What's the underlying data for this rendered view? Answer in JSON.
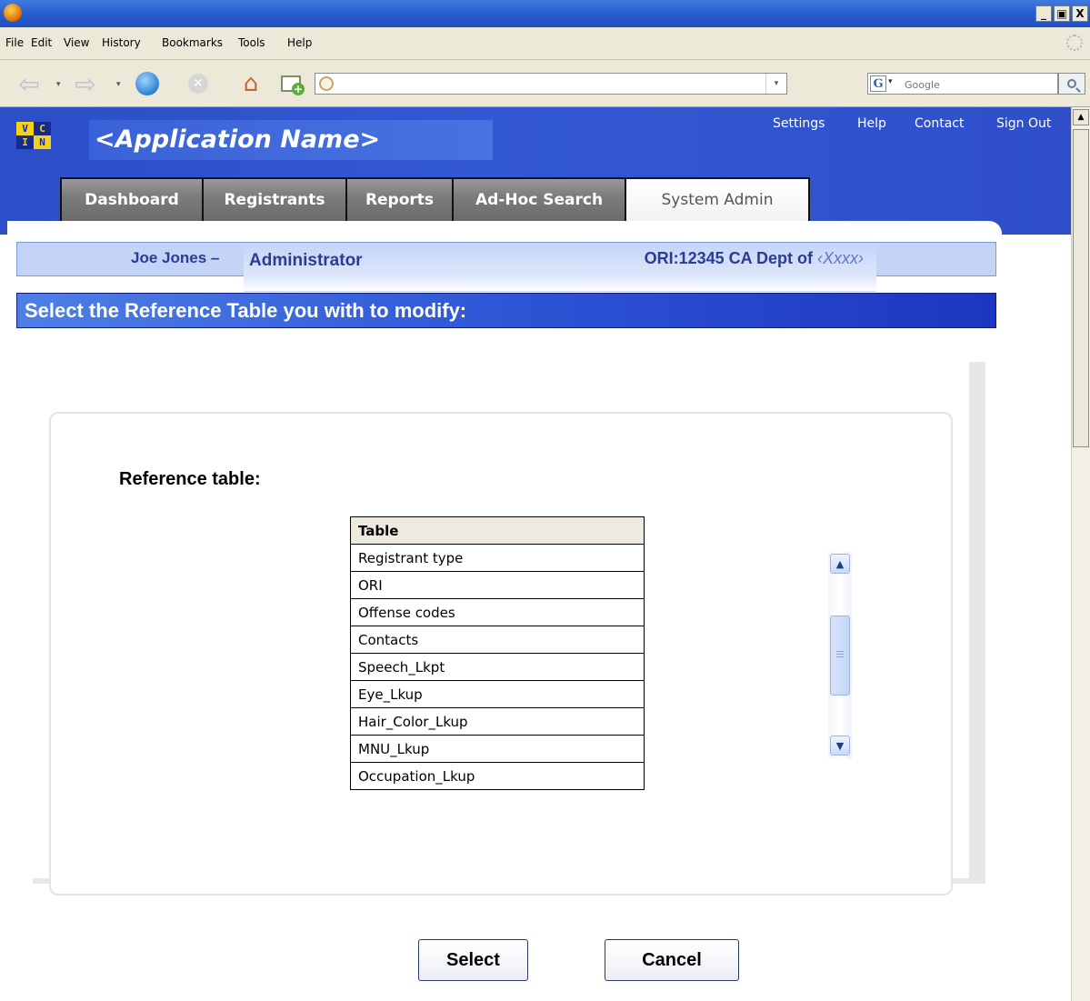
{
  "browser": {
    "menu": [
      "File",
      "Edit",
      "View",
      "History",
      "Bookmarks",
      "Tools",
      "Help"
    ],
    "window_buttons": [
      "_",
      "▣",
      "X"
    ],
    "url": "",
    "search_engine": "G",
    "search_placeholder": "Google"
  },
  "app": {
    "logo": [
      "V",
      "C",
      "I",
      "N"
    ],
    "title": "<Application Name>",
    "top_links": [
      "Settings",
      "Help",
      "Contact",
      "Sign Out"
    ],
    "tabs": [
      {
        "label": "Dashboard",
        "active": false
      },
      {
        "label": "Registrants",
        "active": false
      },
      {
        "label": "Reports",
        "active": false
      },
      {
        "label": "Ad-Hoc Search",
        "active": false
      },
      {
        "label": "System Admin",
        "active": true
      }
    ]
  },
  "user_bar": {
    "name": "Joe Jones –",
    "role": "Administrator",
    "ori_prefix": "ORI:12345 CA Dept of ",
    "ori_suffix": "‹Xxxx›"
  },
  "section": {
    "header": "Select the Reference Table you with to modify:"
  },
  "reference": {
    "label": "Reference table:",
    "column_header": "Table",
    "rows": [
      "Registrant type",
      "ORI",
      "Offense codes",
      "Contacts",
      "Speech_Lkpt",
      "Eye_Lkup",
      "Hair_Color_Lkup",
      "MNU_Lkup",
      "Occupation_Lkup"
    ]
  },
  "buttons": {
    "select": "Select",
    "cancel": "Cancel"
  },
  "colors": {
    "header_blue": "#2f4fca",
    "user_bar": "#c3d4f6",
    "label_blue": "#2a3c94",
    "section_blue": "#2e55d6"
  }
}
